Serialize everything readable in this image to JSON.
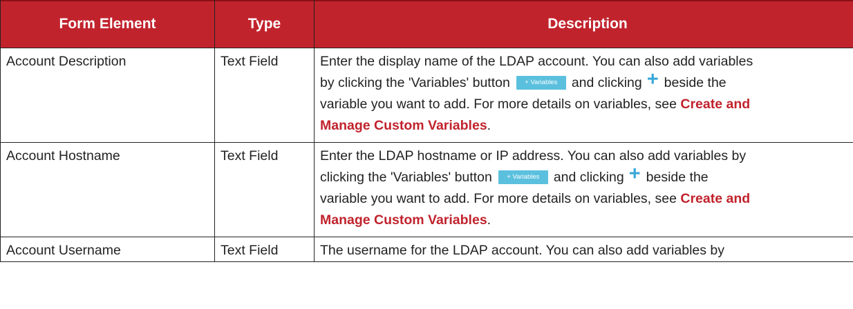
{
  "table": {
    "headers": {
      "form_element": "Form Element",
      "type": "Type",
      "description": "Description"
    },
    "rows": [
      {
        "element": "Account Description",
        "type": "Text Field",
        "desc_line1": "Enter the display name of the LDAP account. You can also add variables",
        "desc_line2_pre": "by clicking the 'Variables' button",
        "variables_button": "+ Variables",
        "desc_line2_mid": "and clicking",
        "plus_symbol": "+",
        "desc_line2_post": "beside the",
        "desc_line3_pre": "variable you want to add. For more details on variables, see ",
        "link_part1": "Create and",
        "link_part2": "Manage Custom Variables",
        "desc_end": "."
      },
      {
        "element": "Account Hostname",
        "type": "Text Field",
        "desc_line1": "Enter the LDAP hostname or IP address. You can also add variables by",
        "desc_line2_pre": "clicking the 'Variables' button",
        "variables_button": "+ Variables",
        "desc_line2_mid": "and clicking",
        "plus_symbol": "+",
        "desc_line2_post": "beside the",
        "desc_line3_pre": "variable you want to add. For more details on variables, see ",
        "link_part1": "Create and",
        "link_part2": "Manage Custom Variables",
        "desc_end": "."
      },
      {
        "element": "Account Username",
        "type": "Text Field",
        "desc_line1": "The username for the LDAP account. You can also add variables by"
      }
    ]
  },
  "colors": {
    "header_bg": "#c1232d",
    "link": "#c1232d",
    "variables_button_bg": "#5bc0de",
    "plus_icon": "#3aa7d8"
  }
}
